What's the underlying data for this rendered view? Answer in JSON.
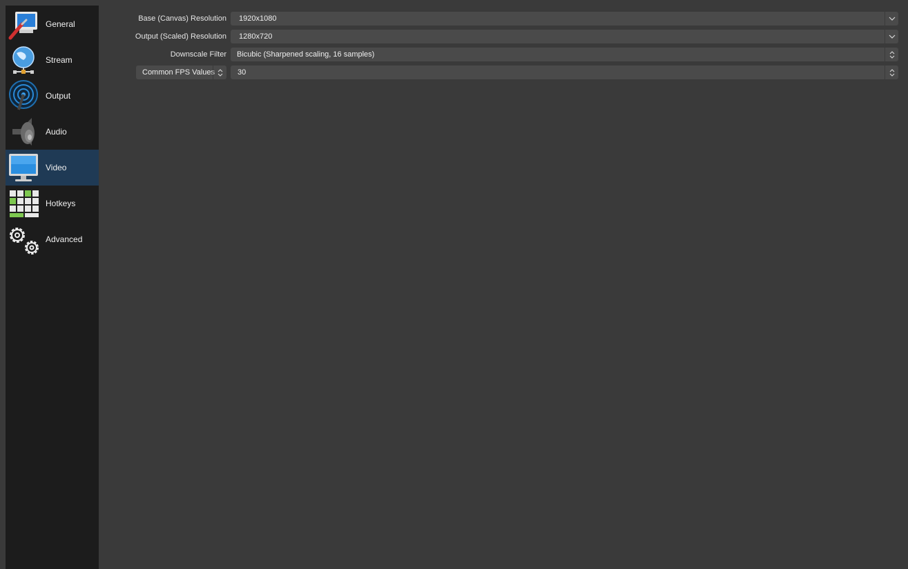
{
  "sidebar": {
    "items": [
      {
        "label": "General",
        "icon": "general-settings-icon"
      },
      {
        "label": "Stream",
        "icon": "stream-globe-icon"
      },
      {
        "label": "Output",
        "icon": "output-antenna-icon"
      },
      {
        "label": "Audio",
        "icon": "speaker-icon"
      },
      {
        "label": "Video",
        "icon": "monitor-icon",
        "selected": true
      },
      {
        "label": "Hotkeys",
        "icon": "keyboard-icon"
      },
      {
        "label": "Advanced",
        "icon": "gears-icon"
      }
    ]
  },
  "video": {
    "base_resolution": {
      "label": "Base (Canvas) Resolution",
      "value": "1920x1080"
    },
    "output_resolution": {
      "label": "Output (Scaled) Resolution",
      "value": "1280x720"
    },
    "downscale_filter": {
      "label": "Downscale Filter",
      "value": "Bicubic (Sharpened scaling, 16 samples)"
    },
    "fps": {
      "type_label": "Common FPS Values",
      "value": "30"
    }
  },
  "colors": {
    "background": "#3a3a3a",
    "sidebar": "#1c1c1c",
    "selected": "#1f3a55",
    "control": "#4a4a4a"
  }
}
